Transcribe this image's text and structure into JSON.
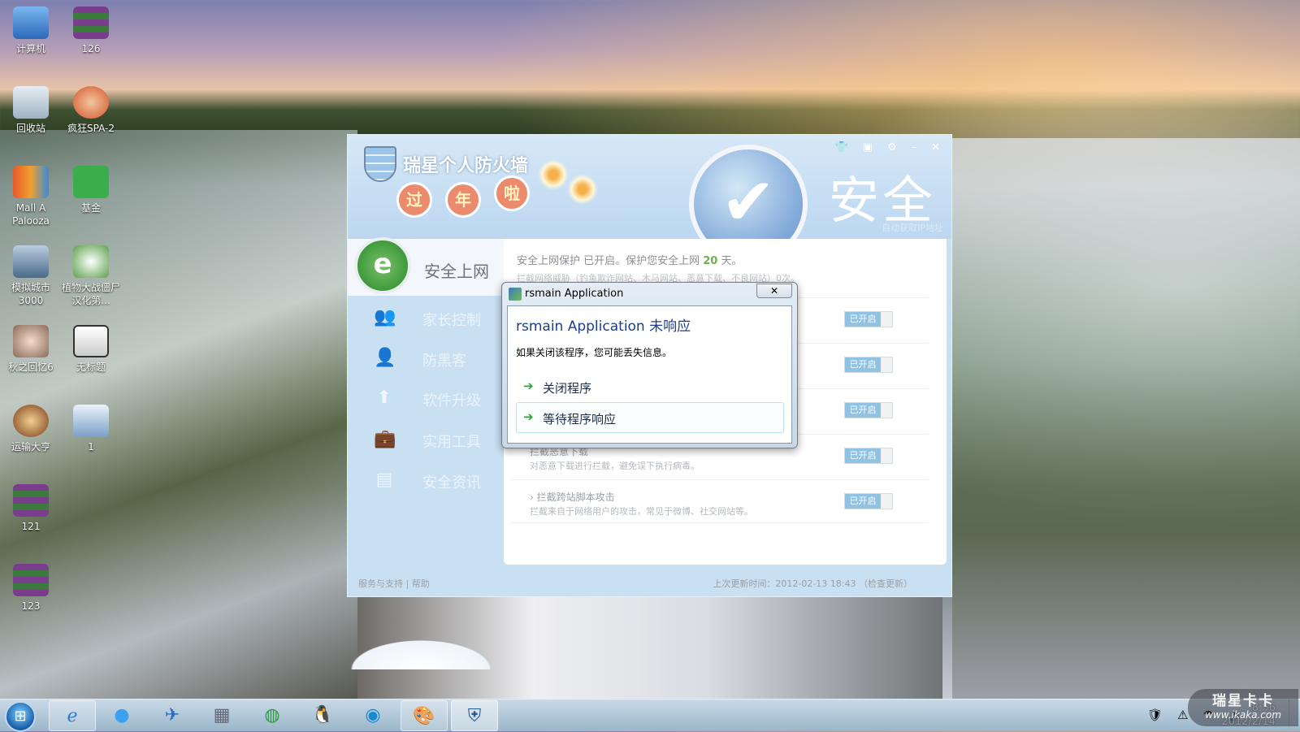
{
  "desktop_icons": [
    {
      "label": "计算机"
    },
    {
      "label": "126"
    },
    {
      "label": "回收站"
    },
    {
      "label": "疯狂SPA-2"
    },
    {
      "label": "Mall A Palooza"
    },
    {
      "label": "基金"
    },
    {
      "label": "模拟城市 3000"
    },
    {
      "label": "植物大战僵尸 汉化第..."
    },
    {
      "label": "秋之回忆6"
    },
    {
      "label": "无标题"
    },
    {
      "label": "运输大亨"
    },
    {
      "label": "1"
    },
    {
      "label": "121"
    },
    {
      "label": "123"
    }
  ],
  "firewall": {
    "brand": "瑞星个人防火墙",
    "lanterns": [
      "过",
      "年",
      "啦"
    ],
    "status_big": "安全",
    "ip_note": "自动获取IP地址",
    "window_buttons": [
      "skin",
      "menu",
      "settings",
      "minimize",
      "close"
    ],
    "nav": [
      {
        "label": "安全上网",
        "active": true
      },
      {
        "label": "家长控制"
      },
      {
        "label": "防黑客"
      },
      {
        "label": "软件升级"
      },
      {
        "label": "实用工具"
      },
      {
        "label": "安全资讯"
      }
    ],
    "status_line_pre": "安全上网保护 已开启。保护您安全上网 ",
    "status_days": "20",
    "status_line_post": " 天。",
    "blocked_line": "拦截网络威胁（钓鱼欺诈网站、木马网站、恶意下载、不良网站）0次。",
    "rows": [
      {
        "title": "",
        "desc": "",
        "toggle": "已开启"
      },
      {
        "title": "",
        "desc": "",
        "toggle": "已开启"
      },
      {
        "title": "",
        "desc": "",
        "toggle": "已开启"
      },
      {
        "title": "拦截恶意下载",
        "desc": "对恶意下载进行拦截，避免误下执行病毒。",
        "toggle": "已开启"
      },
      {
        "title": "拦截跨站脚本攻击",
        "desc": "拦截来自于网络用户的攻击，常见于微博、社交网站等。",
        "toggle": "已开启"
      }
    ],
    "footer_support": "服务与支持",
    "footer_sep": "|",
    "footer_help": "帮助",
    "footer_update": "上次更新时间：2012-02-13 18:43",
    "footer_check": "（检查更新）"
  },
  "dialog": {
    "title": "rsmain Application",
    "heading": "rsmain Application 未响应",
    "message": "如果关闭该程序，您可能丢失信息。",
    "option_close": "关闭程序",
    "option_wait": "等待程序响应",
    "close_glyph": "✕"
  },
  "taskbar": {
    "clock_time": "8:56",
    "clock_date": "2012/2/14",
    "watermark_brand": "瑞星卡卡",
    "watermark_url": "www.ikaka.com"
  }
}
